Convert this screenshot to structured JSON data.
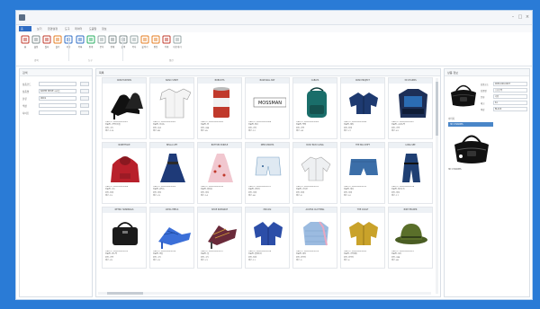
{
  "colors": {
    "accent": "#2f6dc4",
    "frame": "#2a7bd6",
    "selected": "#4a86c8"
  },
  "window": {
    "controls": [
      "–",
      "□",
      "×"
    ]
  },
  "ribbon": {
    "tabs": [
      "홈",
      "보기",
      "환경설정",
      "도구",
      "데이터",
      "도움말",
      "정보"
    ],
    "buttons": [
      {
        "icon": "home-icon",
        "label": "홈"
      },
      {
        "icon": "settings-icon",
        "label": "설정"
      },
      {
        "icon": "filter-icon",
        "label": "필터"
      },
      {
        "icon": "folder-icon",
        "label": "폴더"
      },
      {
        "icon": "save-icon",
        "label": "저장"
      },
      {
        "icon": "table-icon",
        "label": "목록"
      },
      {
        "icon": "chart-icon",
        "label": "통계"
      },
      {
        "icon": "doc-icon",
        "label": "문서"
      },
      {
        "icon": "print-icon",
        "label": "인쇄"
      },
      {
        "icon": "print-icon",
        "label": "출력"
      },
      {
        "icon": "copy-icon",
        "label": "복사"
      },
      {
        "icon": "paste-icon",
        "label": "붙이기"
      },
      {
        "icon": "edit-icon",
        "label": "편집"
      },
      {
        "icon": "delete-icon",
        "label": "삭제"
      },
      {
        "icon": "export-icon",
        "label": "내보내기"
      }
    ],
    "groups": [
      "검색",
      "도구",
      "옵션"
    ]
  },
  "left_panel": {
    "title": "검색",
    "fields": [
      {
        "label": "상품코드",
        "value": ""
      },
      {
        "label": "상품명",
        "value": "RAHM SHOE 시리즈"
      },
      {
        "label": "분류",
        "value": "0001"
      },
      {
        "label": "색상",
        "value": ""
      },
      {
        "label": "사이즈",
        "value": ""
      }
    ]
  },
  "grid": {
    "title": "목록",
    "cards": [
      {
        "title": "RONI FASHION",
        "image": "heels-image",
        "info": [
          "상품코드: 9050-000-0001",
          "상품명: 가죽하이힐",
          "분류: 구두",
          "재고: 120"
        ]
      },
      {
        "title": "BASIC SHIRT",
        "image": "shirt-image",
        "info": [
          "상품코드: 9050-000-0002",
          "상품명: 흰셔츠",
          "분류: 셔츠",
          "재고: 88"
        ]
      },
      {
        "title": "BOBOOTS",
        "image": "can-image",
        "info": [
          "상품코드: 9050-000-0003",
          "상품명: 캔",
          "분류: 소품",
          "재고: 45"
        ]
      },
      {
        "title": "BASE-BALL BAT",
        "image": "banner-image",
        "info": [
          "상품코드: 9050-000-0004",
          "상품명: 배너",
          "분류: 기타",
          "재고: 12"
        ]
      },
      {
        "title": "CABLES",
        "image": "backpack-image",
        "info": [
          "상품코드: 9050-000-0005",
          "상품명: 백팩",
          "분류: 가방",
          "재고: 34"
        ]
      },
      {
        "title": "RONI PROJECT",
        "image": "jacket-image",
        "info": [
          "상품코드: 9050-000-0006",
          "상품명: 재킷",
          "분류: 상의",
          "재고: 27"
        ]
      },
      {
        "title": "3D CHARMS",
        "image": "bag-image",
        "info": [
          "상품코드: 9050-000-0007",
          "상품명: 스포츠백",
          "분류: 가방",
          "재고: 61"
        ]
      },
      {
        "title": "NORTHFACE",
        "image": "hoodie-image",
        "info": [
          "상품코드: 9050-000-0008",
          "상품명: 후드",
          "분류: 상의",
          "재고: 19"
        ]
      },
      {
        "title": "BELLA LIFE",
        "image": "dress-image",
        "info": [
          "상품코드: 9050-000-0009",
          "상품명: 원피스",
          "분류: 여성",
          "재고: 23"
        ]
      },
      {
        "title": "BOTTOM PURPLE",
        "image": "floral-dress-image",
        "info": [
          "상품코드: 9050-000-0010",
          "상품명: 플라워",
          "분류: 여성",
          "재고: 14"
        ]
      },
      {
        "title": "MEN SHORTS",
        "image": "shorts-image",
        "info": [
          "상품코드: 9050-000-0011",
          "상품명: 반바지",
          "분류: 하의",
          "재고: 40"
        ]
      },
      {
        "title": "BUSY BUSY LONG",
        "image": "cardigan-image",
        "info": [
          "상품코드: 9050-000-0012",
          "상품명: 가디건",
          "분류: 상의",
          "재고: 8"
        ]
      },
      {
        "title": "THE BIG SHIFT",
        "image": "denim-shorts-image",
        "info": [
          "상품코드: 9050-000-0013",
          "상품명: 데님",
          "분류: 하의",
          "재고: 52"
        ]
      },
      {
        "title": "LONG SEE",
        "image": "jumpsuit-image",
        "info": [
          "상품코드: 9050-000-0014",
          "상품명: 점프수트",
          "분류: 여성",
          "재고: 17"
        ]
      },
      {
        "title": "RETRO HANDBAGS",
        "image": "handbag-image",
        "info": [
          "상품코드: 9050-000-0015",
          "상품명: 핸드백",
          "분류: 가방",
          "재고: 29"
        ]
      },
      {
        "title": "ULTRA HEELS",
        "image": "sandals-image",
        "info": [
          "상품코드: 9050-000-0016",
          "상품명: 샌들",
          "분류: 구두",
          "재고: 33"
        ]
      },
      {
        "title": "SHOE ROMANCE",
        "image": "strappy-heels-image",
        "info": [
          "상품코드: 9050-000-0017",
          "상품명: 힐",
          "분류: 구두",
          "재고: 21"
        ]
      },
      {
        "title": "MOCASI",
        "image": "blazer-image",
        "info": [
          "상품코드: 9050-000-0018",
          "상품명: 블레이저",
          "분류: 상의",
          "재고: 11"
        ]
      },
      {
        "title": "ACCESS CLOTHING",
        "image": "puffer-image",
        "info": [
          "상품코드: 9050-000-0019",
          "상품명: 패딩",
          "분류: 아우터",
          "재고: 9"
        ]
      },
      {
        "title": "THE COAST",
        "image": "leather-jacket-image",
        "info": [
          "상품코드: 9050-000-0020",
          "상품명: 가죽재킷",
          "분류: 아우터",
          "재고: 6"
        ]
      },
      {
        "title": "BIKE HEADER",
        "image": "hat-image",
        "info": [
          "상품코드: 9050-000-0021",
          "상품명: 모자",
          "분류: 소품",
          "재고: 48"
        ]
      }
    ]
  },
  "right_panel": {
    "title": "상품 정보",
    "fields": [
      {
        "label": "상품코드",
        "value": "9050-000-0007"
      },
      {
        "label": "상품명",
        "value": "스포츠백"
      },
      {
        "label": "분류",
        "value": "가방"
      },
      {
        "label": "재고",
        "value": "61"
      },
      {
        "label": "색상",
        "value": "BLACK"
      }
    ],
    "section": "이미지",
    "selected_label": "3D CHARMS",
    "caption": "3D CHARMS"
  }
}
